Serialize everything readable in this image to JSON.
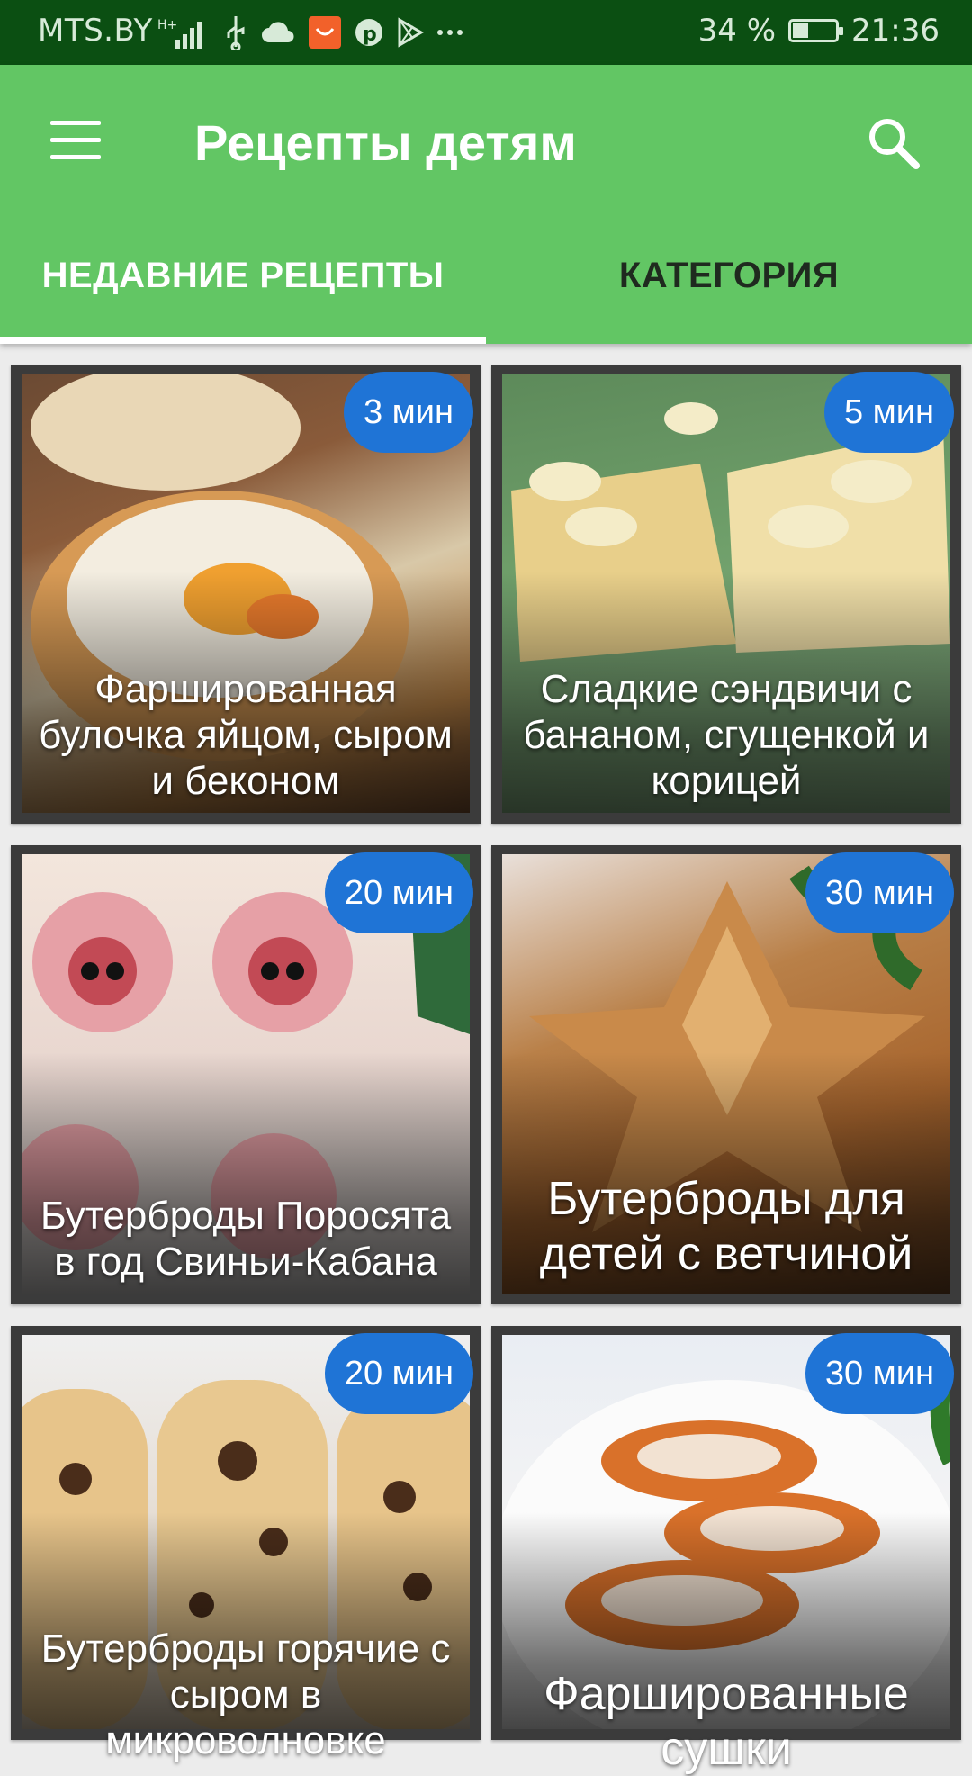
{
  "status_bar": {
    "carrier": "MTS.BY",
    "icons": [
      "network-hplus-icon",
      "signal-icon",
      "usb-icon",
      "cloud-icon",
      "aliexpress-icon",
      "pinterest-icon",
      "play-store-icon",
      "more-dots-icon"
    ],
    "battery_percent": "34 %",
    "battery_level": 0.34,
    "time": "21:36"
  },
  "app_bar": {
    "title": "Рецепты детям",
    "accent_color": "#62c664",
    "tabs": [
      {
        "label": "НЕДАВНИЕ РЕЦЕПТЫ",
        "selected": true
      },
      {
        "label": "КАТЕГОРИЯ",
        "selected": false
      }
    ]
  },
  "recipes": [
    {
      "title": "Фаршированная булочка яйцом, сыром и беконом",
      "time": "3 мин"
    },
    {
      "title": "Сладкие сэндвичи с бананом, сгущенкой и корицей",
      "time": "5 мин"
    },
    {
      "title": "Бутерброды Поросята в год Свиньи-Кабана",
      "time": "20 мин"
    },
    {
      "title": "Бутерброды для детей с ветчиной",
      "time": "30 мин"
    },
    {
      "title": "Бутерброды горячие с сыром в микроволновке",
      "time": "20 мин"
    },
    {
      "title": "Фаршированные сушки",
      "time": "30 мин"
    }
  ],
  "badge_color": "#1f74d6"
}
